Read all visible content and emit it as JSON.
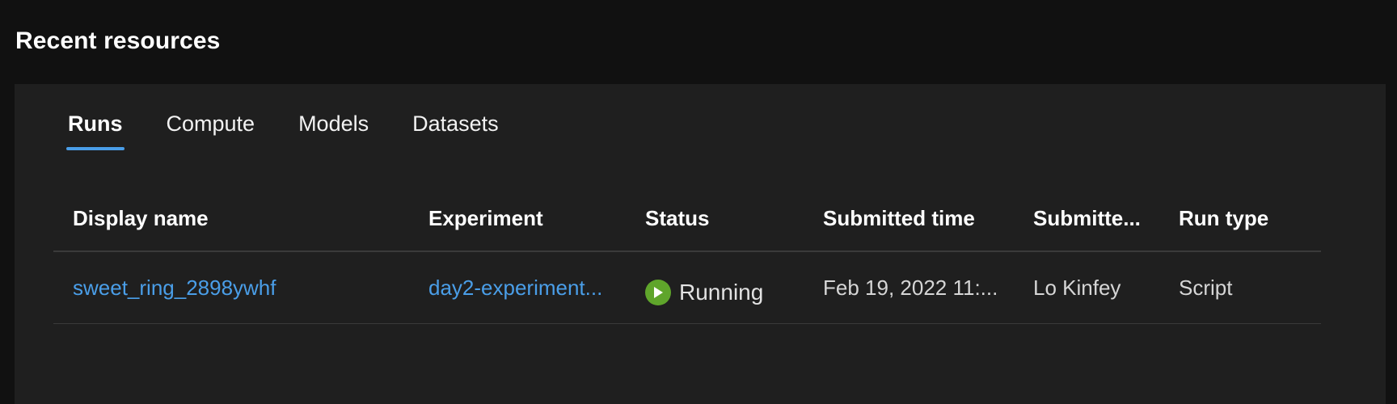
{
  "section": {
    "title": "Recent resources"
  },
  "tabs": [
    {
      "label": "Runs",
      "active": true
    },
    {
      "label": "Compute",
      "active": false
    },
    {
      "label": "Models",
      "active": false
    },
    {
      "label": "Datasets",
      "active": false
    }
  ],
  "table": {
    "columns": [
      "Display name",
      "Experiment",
      "Status",
      "Submitted time",
      "Submitte...",
      "Run type"
    ],
    "rows": [
      {
        "display_name": "sweet_ring_2898ywhf",
        "experiment": "day2-experiment...",
        "status": "Running",
        "status_icon": "play-icon",
        "submitted_time": "Feb 19, 2022 11:...",
        "submitted_by": "Lo Kinfey",
        "run_type": "Script"
      }
    ]
  },
  "colors": {
    "accent": "#4a9ee8",
    "running": "#5fa52b",
    "panel": "#1f1f1f",
    "background": "#111111"
  }
}
